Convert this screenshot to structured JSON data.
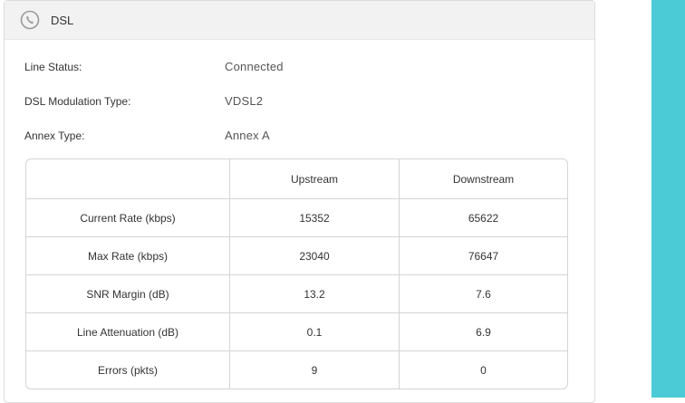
{
  "panel": {
    "title": "DSL",
    "icon": "phone-icon"
  },
  "info": [
    {
      "label": "Line Status:",
      "value": "Connected"
    },
    {
      "label": "DSL Modulation Type:",
      "value": "VDSL2"
    },
    {
      "label": "Annex Type:",
      "value": "Annex A"
    }
  ],
  "table": {
    "headers": [
      "",
      "Upstream",
      "Downstream"
    ],
    "rows": [
      [
        "Current Rate (kbps)",
        "15352",
        "65622"
      ],
      [
        "Max Rate (kbps)",
        "23040",
        "76647"
      ],
      [
        "SNR Margin (dB)",
        "13.2",
        "7.6"
      ],
      [
        "Line Attenuation (dB)",
        "0.1",
        "6.9"
      ],
      [
        "Errors (pkts)",
        "9",
        "0"
      ]
    ]
  },
  "colors": {
    "accent": "#4acbd6",
    "header_bg": "#f2f2f2",
    "border": "#d4d4d4"
  }
}
